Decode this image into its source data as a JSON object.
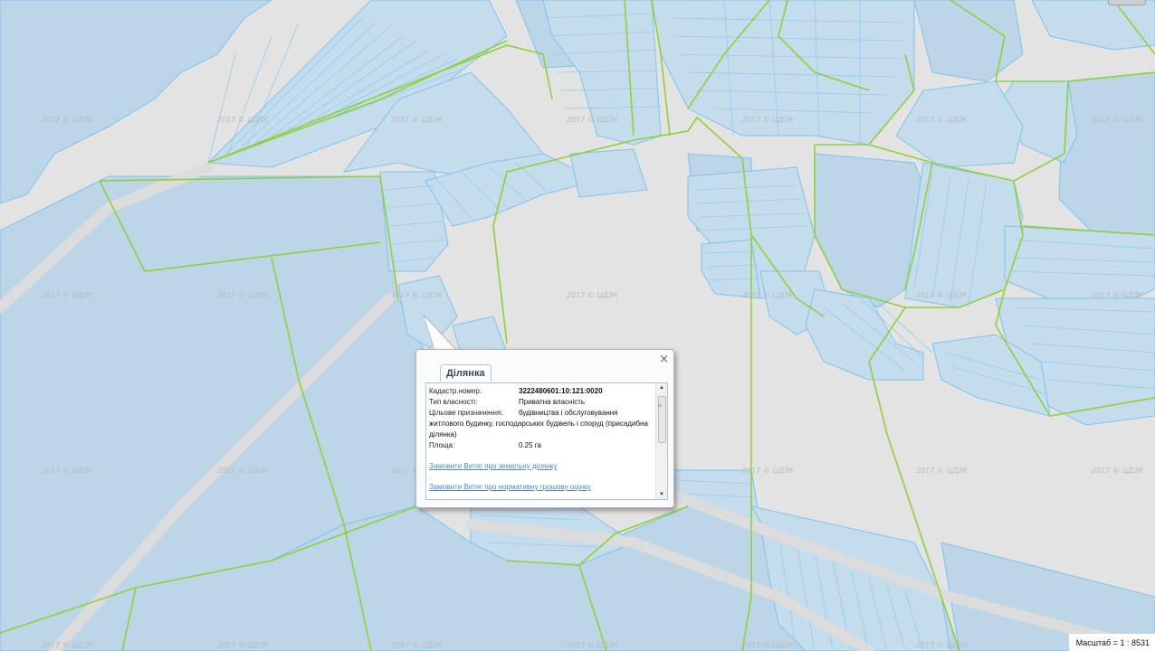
{
  "map": {
    "watermark_text": "2017 © ЦДЗК",
    "colors": {
      "background": "#e3e3e3",
      "parcel_fill": "#bcd6e8",
      "parcel_stroke": "#7ec3ee",
      "boundary": "#8fd13a"
    }
  },
  "popup": {
    "tab_label": "Ділянка",
    "close_icon": "×",
    "fields": [
      {
        "label": "Кадастр.номер:",
        "value": "3222480601:10:121:0020"
      },
      {
        "label": "Тип власності:",
        "value": "Приватна власність"
      },
      {
        "label": "Цільове призначення:",
        "value": "будівництва і обслуговування"
      }
    ],
    "purpose_continuation": "житлового будинку, господарських будівель і споруд (присадибна ділянка)",
    "area": {
      "label": "Площа:",
      "value": "0.25 га"
    },
    "links": [
      "Замовити Витяг про земельну ділянку",
      "Замовити Витяг про нормативну грошову оцінку"
    ]
  },
  "scale_text": "Масштаб = 1 : 8531"
}
